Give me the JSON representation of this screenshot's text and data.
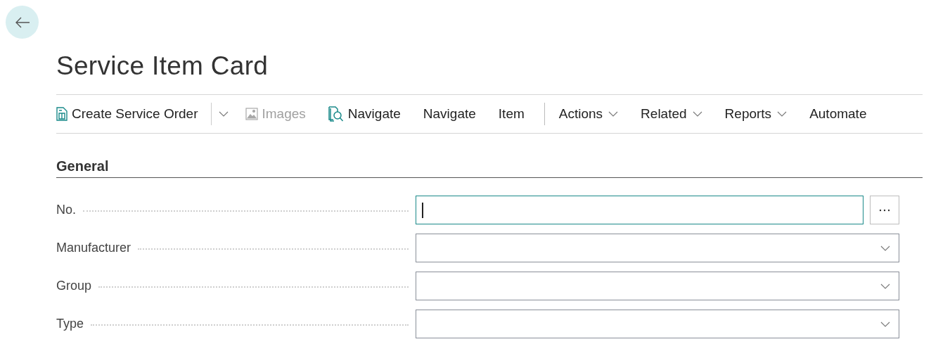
{
  "page": {
    "title": "Service Item Card"
  },
  "toolbar": {
    "actions": [
      {
        "label": "Create Service Order",
        "kind": "split",
        "disabled": false
      },
      {
        "label": "Images",
        "kind": "button",
        "disabled": true
      },
      {
        "label": "Navigate",
        "kind": "button",
        "disabled": false
      },
      {
        "label": "Navigate",
        "kind": "button",
        "disabled": false
      },
      {
        "label": "Item",
        "kind": "button",
        "disabled": false
      }
    ],
    "menus": [
      {
        "label": "Actions",
        "kind": "menu"
      },
      {
        "label": "Related",
        "kind": "menu"
      },
      {
        "label": "Reports",
        "kind": "menu"
      },
      {
        "label": "Automate",
        "kind": "button"
      }
    ]
  },
  "section": {
    "title": "General",
    "fields": [
      {
        "label": "No.",
        "kind": "lookup",
        "focused": true
      },
      {
        "label": "Manufacturer",
        "kind": "dropdown",
        "focused": false
      },
      {
        "label": "Group",
        "kind": "dropdown",
        "focused": false
      },
      {
        "label": "Type",
        "kind": "dropdown",
        "focused": false
      }
    ]
  }
}
